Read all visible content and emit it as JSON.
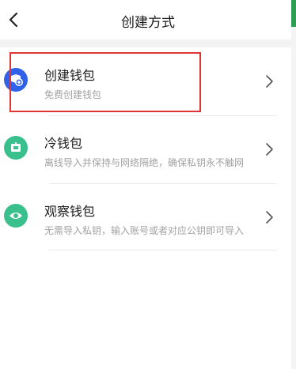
{
  "header": {
    "title": "创建方式",
    "back_icon": "chevron-left-icon"
  },
  "items": [
    {
      "title": "创建钱包",
      "subtitle": "免费创建钱包",
      "icon": "wallet-add-icon",
      "color": "#2f62e8"
    },
    {
      "title": "冷钱包",
      "subtitle": "离线导入并保持与网络隔绝，确保私钥永不触网",
      "icon": "cold-wallet-icon",
      "color": "#39c08c"
    },
    {
      "title": "观察钱包",
      "subtitle": "无需导入私钥，输入账号或者对应公钥即可导入",
      "icon": "eye-icon",
      "color": "#39c08c"
    }
  ],
  "colors": {
    "accent": "#2f9e55",
    "highlight": "#e03535",
    "blue": "#2f62e8",
    "green": "#39c08c"
  }
}
